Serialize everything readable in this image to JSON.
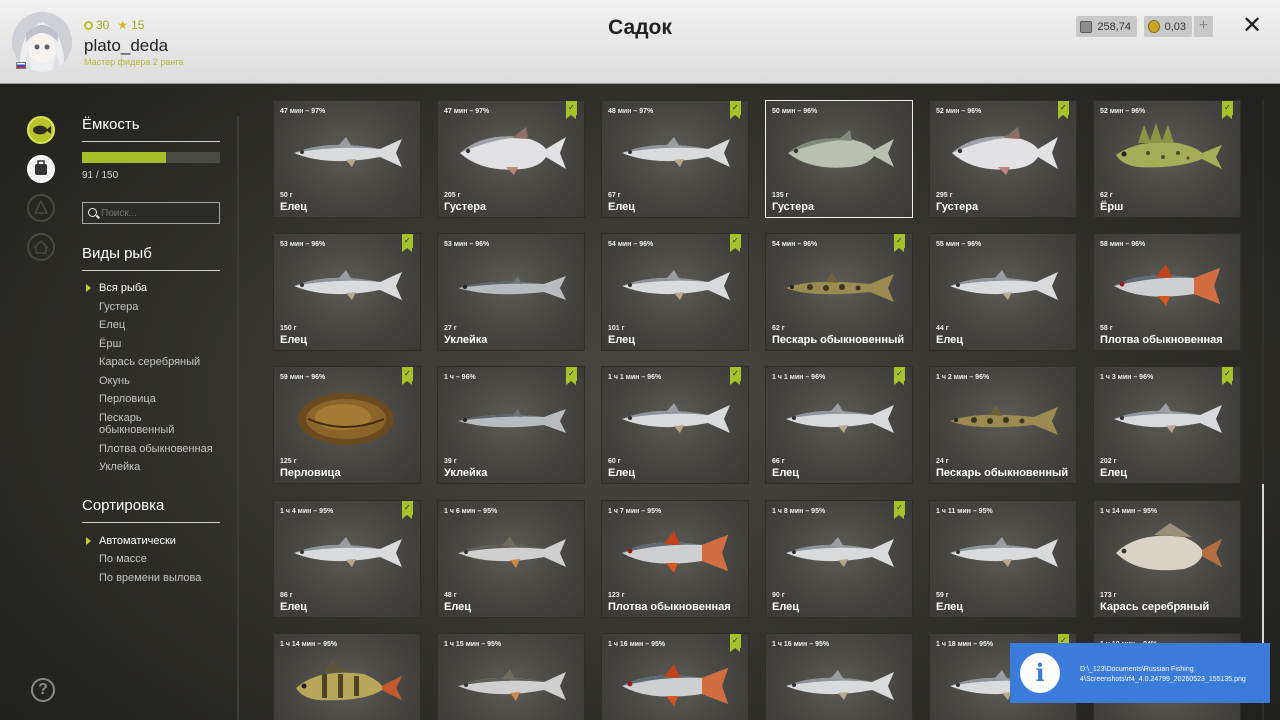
{
  "header": {
    "title": "Садок",
    "username": "plato_deda",
    "rank": "Мастер фидера 2 ранга",
    "level": "30",
    "stars": "15",
    "silver": "258,74",
    "gold": "0,03",
    "plus": "+",
    "close": "✕"
  },
  "sidebar": {
    "capacity_title": "Ёмкость",
    "capacity_text": "91 / 150",
    "capacity_fraction": 0.607,
    "search_placeholder": "Поиск...",
    "species_title": "Виды рыб",
    "species": [
      "Вся рыба",
      "Густера",
      "Елец",
      "Ёрш",
      "Карась серебряный",
      "Окунь",
      "Перловица",
      "Пескарь обыкновенный",
      "Плотва обыкновенная",
      "Уклейка"
    ],
    "sort_title": "Сортировка",
    "sort_options": [
      "Автоматически",
      "По массе",
      "По времени вылова"
    ]
  },
  "cards": [
    {
      "time": "47 мин – 97%",
      "weight": "50 г",
      "name": "Елец",
      "checked": false,
      "kind": "elets"
    },
    {
      "time": "47 мин – 97%",
      "weight": "205 г",
      "name": "Густера",
      "checked": true,
      "kind": "gustera"
    },
    {
      "time": "48 мин – 97%",
      "weight": "67 г",
      "name": "Елец",
      "checked": true,
      "kind": "elets"
    },
    {
      "time": "50 мин – 96%",
      "weight": "135 г",
      "name": "Густера",
      "checked": false,
      "kind": "gustera2",
      "selected": true
    },
    {
      "time": "52 мин – 96%",
      "weight": "295 г",
      "name": "Густера",
      "checked": true,
      "kind": "gustera"
    },
    {
      "time": "52 мин – 96%",
      "weight": "62 г",
      "name": "Ёрш",
      "checked": true,
      "kind": "ersh"
    },
    {
      "time": "53 мин – 96%",
      "weight": "150 г",
      "name": "Елец",
      "checked": true,
      "kind": "elets"
    },
    {
      "time": "53 мин – 96%",
      "weight": "27 г",
      "name": "Уклейка",
      "checked": false,
      "kind": "ukleika"
    },
    {
      "time": "54 мин – 96%",
      "weight": "101 г",
      "name": "Елец",
      "checked": true,
      "kind": "elets"
    },
    {
      "time": "54 мин – 96%",
      "weight": "62 г",
      "name": "Пескарь обыкновенный",
      "checked": true,
      "kind": "peskar"
    },
    {
      "time": "55 мин – 96%",
      "weight": "44 г",
      "name": "Елец",
      "checked": false,
      "kind": "elets"
    },
    {
      "time": "58 мин – 96%",
      "weight": "58 г",
      "name": "Плотва обыкновенная",
      "checked": false,
      "kind": "plotva"
    },
    {
      "time": "59 мин – 96%",
      "weight": "125 г",
      "name": "Перловица",
      "checked": true,
      "kind": "perlovitsa"
    },
    {
      "time": "1 ч – 96%",
      "weight": "39 г",
      "name": "Уклейка",
      "checked": true,
      "kind": "ukleika"
    },
    {
      "time": "1 ч 1 мин – 96%",
      "weight": "60 г",
      "name": "Елец",
      "checked": true,
      "kind": "elets"
    },
    {
      "time": "1 ч 1 мин – 96%",
      "weight": "66 г",
      "name": "Елец",
      "checked": true,
      "kind": "elets"
    },
    {
      "time": "1 ч 2 мин – 96%",
      "weight": "24 г",
      "name": "Пескарь обыкновенный",
      "checked": false,
      "kind": "peskar"
    },
    {
      "time": "1 ч 3 мин – 96%",
      "weight": "202 г",
      "name": "Елец",
      "checked": true,
      "kind": "elets"
    },
    {
      "time": "1 ч 4 мин – 95%",
      "weight": "86 г",
      "name": "Елец",
      "checked": true,
      "kind": "elets"
    },
    {
      "time": "1 ч 6 мин – 95%",
      "weight": "48 г",
      "name": "Елец",
      "checked": false,
      "kind": "elets2"
    },
    {
      "time": "1 ч 7 мин – 95%",
      "weight": "123 г",
      "name": "Плотва обыкновенная",
      "checked": false,
      "kind": "plotva"
    },
    {
      "time": "1 ч 8 мин – 95%",
      "weight": "90 г",
      "name": "Елец",
      "checked": true,
      "kind": "elets"
    },
    {
      "time": "1 ч 11 мин – 95%",
      "weight": "59 г",
      "name": "Елец",
      "checked": false,
      "kind": "elets"
    },
    {
      "time": "1 ч 14 мин – 95%",
      "weight": "173 г",
      "name": "Карась серебряный",
      "checked": false,
      "kind": "karas"
    },
    {
      "time": "1 ч 14 мин – 95%",
      "weight": "",
      "name": "",
      "checked": false,
      "kind": "okun"
    },
    {
      "time": "1 ч 15 мин – 95%",
      "weight": "",
      "name": "",
      "checked": false,
      "kind": "elets2"
    },
    {
      "time": "1 ч 16 мин – 95%",
      "weight": "",
      "name": "",
      "checked": true,
      "kind": "plotva"
    },
    {
      "time": "1 ч 16 мин – 95%",
      "weight": "",
      "name": "",
      "checked": false,
      "kind": "elets"
    },
    {
      "time": "1 ч 18 мин – 95%",
      "weight": "",
      "name": "",
      "checked": true,
      "kind": "elets"
    },
    {
      "time": "1 ч 19 мин – 94%",
      "weight": "",
      "name": "",
      "checked": false,
      "kind": "elets"
    }
  ],
  "notification": {
    "text": "D:\\_123\\Documents\\Russian Fishing 4\\Screenshots\\rf4_4.0.24799_20260523_155135.png"
  },
  "colors": {
    "accent": "#a6c22a",
    "header_bg": "#e8e8e8",
    "toast": "#3b7bd9"
  }
}
